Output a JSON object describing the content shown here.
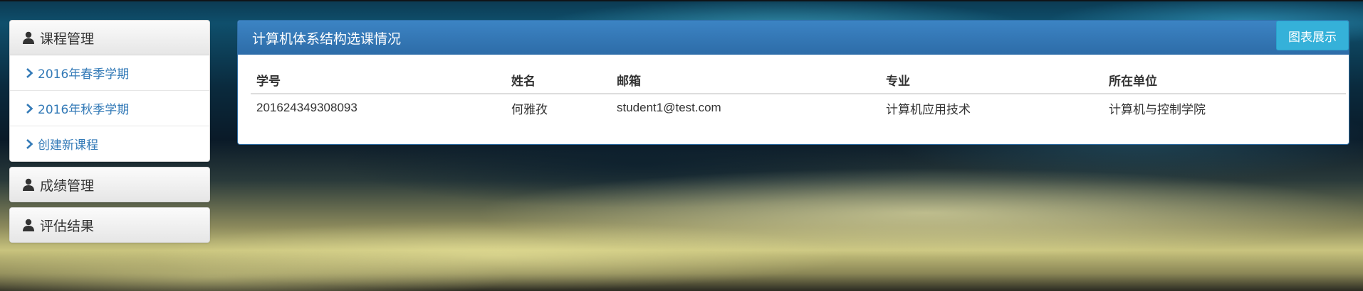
{
  "sidebar": {
    "sections": [
      {
        "title": "课程管理",
        "icon": "user-icon",
        "items": [
          {
            "label": "2016年春季学期"
          },
          {
            "label": "2016年秋季学期"
          },
          {
            "label": "创建新课程"
          }
        ]
      },
      {
        "title": "成绩管理",
        "icon": "user-icon"
      },
      {
        "title": "评估结果",
        "icon": "user-icon"
      }
    ]
  },
  "main": {
    "title": "计算机体系结构选课情况",
    "chart_button": "图表展示",
    "table": {
      "columns": [
        "学号",
        "姓名",
        "邮箱",
        "专业",
        "所在单位"
      ],
      "rows": [
        [
          "201624349308093",
          "何雅孜",
          "student1@test.com",
          "计算机应用技术",
          "计算机与控制学院"
        ]
      ]
    }
  },
  "colors": {
    "accent": "#337ab7",
    "header_blue": "#3379b7",
    "info_button": "#35b1d9"
  }
}
